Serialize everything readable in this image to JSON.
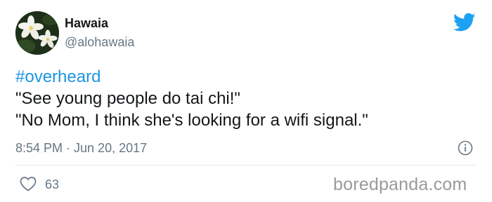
{
  "author": {
    "display_name": "Hawaia",
    "handle": "@alohawaia"
  },
  "tweet": {
    "hashtag": "#overheard",
    "line1": "\"See young people do tai chi!\"",
    "line2": "\"No Mom, I think she's looking for a wifi signal.\"",
    "timestamp": "8:54 PM · Jun 20, 2017"
  },
  "engagement": {
    "like_count": "63"
  },
  "watermark": "boredpanda.com",
  "icons": {
    "brand": "twitter-bird-icon",
    "info": "info-icon",
    "like": "heart-icon"
  },
  "colors": {
    "brand_blue": "#1da1f2",
    "hashtag_blue": "#1b95e0",
    "secondary_text": "#657786"
  }
}
